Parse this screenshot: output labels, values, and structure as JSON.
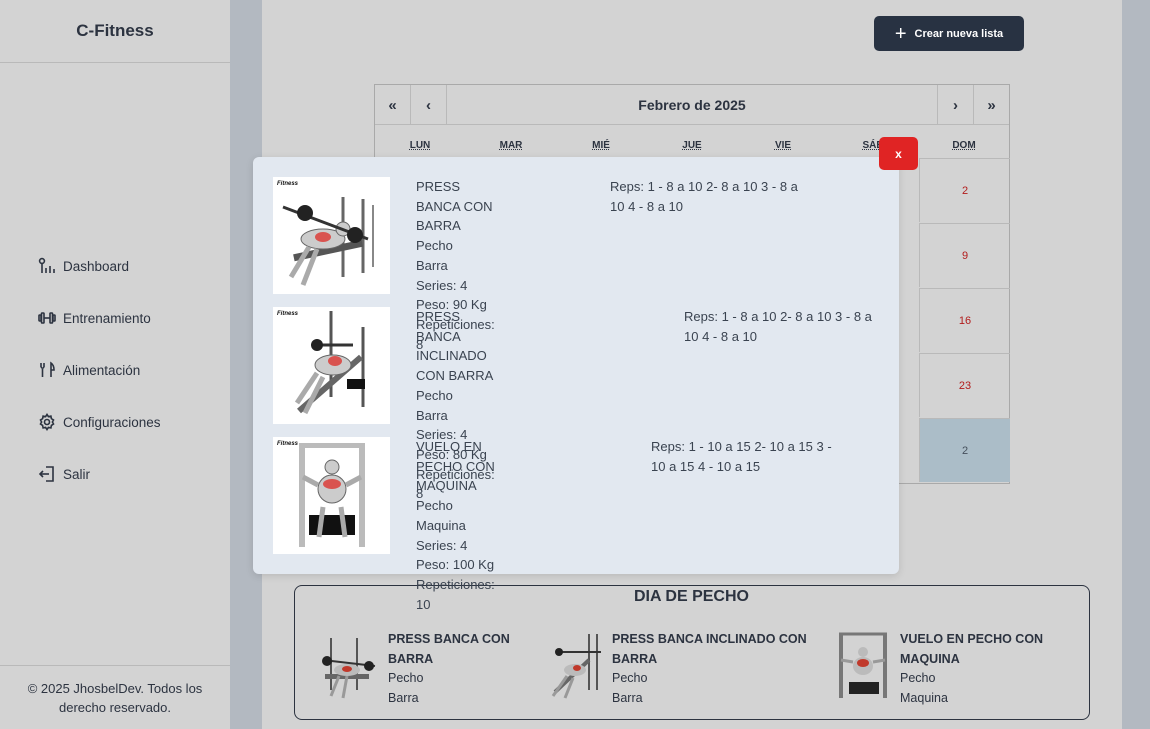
{
  "app": {
    "brand": "C-Fitness"
  },
  "sidebar": {
    "items": [
      {
        "label": "Dashboard",
        "icon": "chart-icon"
      },
      {
        "label": "Entrenamiento",
        "icon": "dumbbell-icon"
      },
      {
        "label": "Alimentación",
        "icon": "utensils-icon"
      },
      {
        "label": "Configuraciones",
        "icon": "gear-icon"
      },
      {
        "label": "Salir",
        "icon": "logout-icon"
      }
    ],
    "footer": "© 2025 JhosbelDev. Todos los derecho reservado."
  },
  "toolbar": {
    "create_label": "Crear nueva lista",
    "create_icon": "+"
  },
  "calendar": {
    "title": "Febrero de 2025",
    "nav": {
      "first": "«",
      "prev": "‹",
      "next": "›",
      "last": "»"
    },
    "weekdays": [
      "LUN",
      "MAR",
      "MIÉ",
      "JUE",
      "VIE",
      "SÁB",
      "DOM"
    ],
    "sunday_days": [
      "2",
      "9",
      "16",
      "23",
      "2"
    ]
  },
  "modal": {
    "close_label": "x",
    "exercises": [
      {
        "name": "PRESS BANCA CON BARRA",
        "muscle": "Pecho",
        "equipment": "Barra",
        "series": "Series: 4",
        "weight": "Peso: 90 Kg",
        "reps_count": "Repeticiones: 8",
        "reps_detail": "Reps: 1 - 8 a 10 2- 8 a 10 3 - 8 a 10 4 - 8 a 10"
      },
      {
        "name": "PRESS BANCA INCLINADO CON BARRA",
        "muscle": "Pecho",
        "equipment": "Barra",
        "series": "Series: 4",
        "weight": "Peso: 80 Kg",
        "reps_count": "Repeticiones: 8",
        "reps_detail": "Reps: 1 - 8 a 10 2- 8 a 10 3 - 8 a 10 4 - 8 a 10"
      },
      {
        "name": "VUELO EN PECHO CON MAQUINA",
        "muscle": "Pecho",
        "equipment": "Maquina",
        "series": "Series: 4",
        "weight": "Peso: 100 Kg",
        "reps_count": "Repeticiones: 10",
        "reps_detail": "Reps: 1 - 10 a 15 2- 10 a 15 3 - 10 a 15 4 - 10 a 15"
      }
    ]
  },
  "day_card": {
    "title": "DIA DE PECHO",
    "exercises": [
      {
        "name": "PRESS BANCA CON BARRA",
        "muscle": "Pecho",
        "equipment": "Barra"
      },
      {
        "name": "PRESS BANCA INCLINADO CON BARRA",
        "muscle": "Pecho",
        "equipment": "Barra"
      },
      {
        "name": "VUELO EN PECHO CON MAQUINA",
        "muscle": "Pecho",
        "equipment": "Maquina"
      }
    ]
  },
  "image_logo_text": "Fitness"
}
